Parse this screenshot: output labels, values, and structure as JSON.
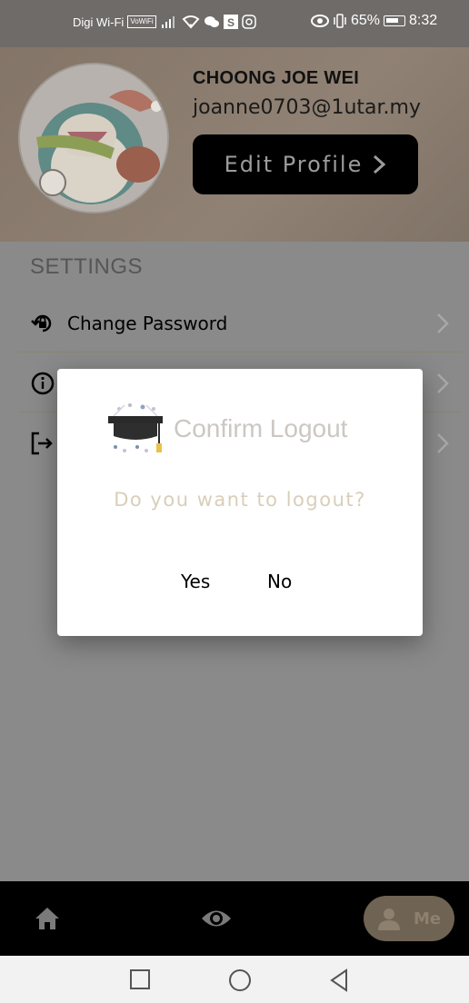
{
  "status_bar": {
    "carrier": "Digi Wi-Fi",
    "volte": "VoWiFi",
    "battery": "65%",
    "time": "8:32"
  },
  "profile": {
    "name": "CHOONG JOE WEI",
    "email": "joanne0703@1utar.my",
    "edit_label": "Edit Profile"
  },
  "settings": {
    "title": "SETTINGS",
    "items": [
      {
        "label": "Change Password",
        "icon": "lock-reset-icon"
      },
      {
        "label": "",
        "icon": "info-icon"
      },
      {
        "label": "",
        "icon": "logout-icon"
      }
    ]
  },
  "dialog": {
    "title": "Confirm Logout",
    "message": "Do you want to logout?",
    "yes_label": "Yes",
    "no_label": "No"
  },
  "bottom_nav": {
    "items": [
      {
        "label": "",
        "icon": "home-icon"
      },
      {
        "label": "",
        "icon": "eye-icon"
      },
      {
        "label": "Me",
        "icon": "person-icon"
      }
    ]
  },
  "colors": {
    "dialog_title": "#cbc7c3",
    "dialog_message": "#d9ceb9",
    "nav_me_pill": "#6f6354",
    "edit_button": "#000000"
  }
}
